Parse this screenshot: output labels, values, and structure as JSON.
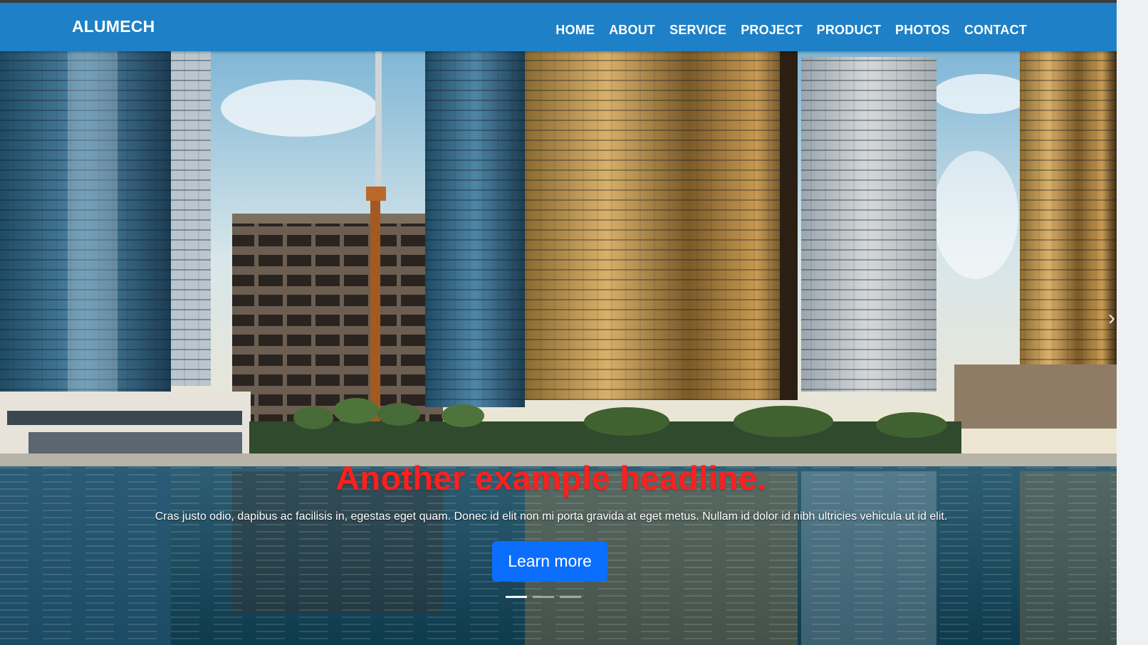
{
  "brand": {
    "name": "ALUMECH"
  },
  "nav": {
    "items": [
      {
        "label": "HOME"
      },
      {
        "label": "ABOUT"
      },
      {
        "label": "SERVICE"
      },
      {
        "label": "PROJECT"
      },
      {
        "label": "PRODUCT"
      },
      {
        "label": "PHOTOS"
      },
      {
        "label": "CONTACT"
      }
    ]
  },
  "carousel": {
    "headline": "Another example headline.",
    "description": "Cras justo odio, dapibus ac facilisis in, egestas eget quam. Donec id elit non mi porta gravida at eget metus. Nullam id dolor id nibh ultricies vehicula ut id elit.",
    "button_label": "Learn more",
    "next_icon": "chevron-right-icon",
    "slide_count": 3,
    "active_slide": 1
  },
  "colors": {
    "navbar": "#1e80c6",
    "headline": "#ff1f1f",
    "button": "#0b6efd"
  }
}
